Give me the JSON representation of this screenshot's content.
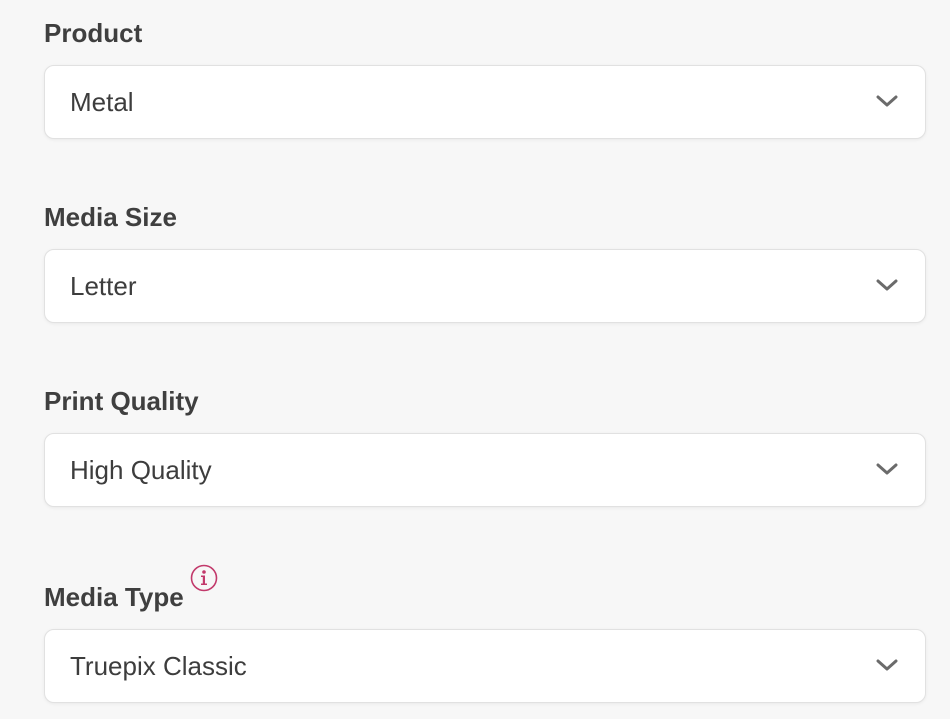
{
  "fields": [
    {
      "label": "Product",
      "value": "Metal"
    },
    {
      "label": "Media Size",
      "value": "Letter"
    },
    {
      "label": "Print Quality",
      "value": "High Quality"
    },
    {
      "label": "Media Type",
      "value": "Truepix Classic"
    }
  ],
  "icons": {
    "dropdown": "chevron-down-icon",
    "info": "info-icon"
  },
  "colors": {
    "background": "#f7f7f7",
    "label": "#3f3f3f",
    "chevron": "#6b6b6b",
    "info_accent": "#c2396b"
  }
}
